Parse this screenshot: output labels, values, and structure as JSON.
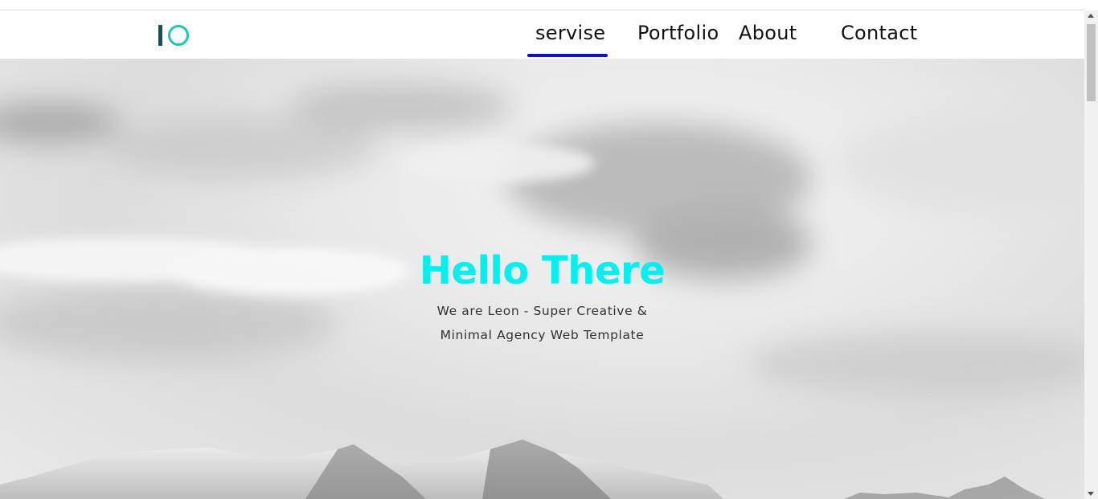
{
  "nav": {
    "items": [
      {
        "label": "servise",
        "active": true
      },
      {
        "label": "Portfolio"
      },
      {
        "label": "About"
      },
      {
        "label": "Contact"
      }
    ],
    "active_color": "#0f0fd6"
  },
  "logo": {
    "bar_color": "#1a4f5a",
    "ring_color": "#20c4b2"
  },
  "hero": {
    "title": "Hello There",
    "subtitle_line1": "We are Leon - Super Creative &",
    "subtitle_line2": "Minimal Agency Web Template",
    "title_color": "#00f0f0"
  }
}
